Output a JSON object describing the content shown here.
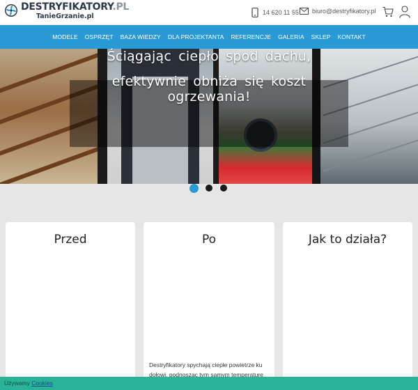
{
  "header": {
    "logo_main": "DESTRYFIKATORY",
    "logo_tld": ".PL",
    "logo_sub": "TanieGrzanie.pl",
    "phone": "14 620 11 55",
    "email": "biuro@destryfikatory.pl",
    "icons": [
      "fan-logo-icon",
      "phone-icon",
      "mail-icon",
      "cart-icon",
      "user-icon"
    ]
  },
  "nav": {
    "items": [
      "MODELE",
      "OSPRZĘT",
      "BAZA WIEDZY",
      "DLA PROJEKTANTA",
      "REFERENCJE",
      "GALERIA",
      "SKLEP",
      "KONTAKT"
    ]
  },
  "hero": {
    "line1": "Ściągając ciepło spod dachu,",
    "line2": "efektywnie obniża się koszt ogrzewania!",
    "slides": 3,
    "active_slide": 1
  },
  "cards": [
    {
      "title": "Przed",
      "text": ""
    },
    {
      "title": "Po",
      "text": "Destryfikatory spychają ciepłe powietrze ku dołowi, podnosząc tym samym temperature"
    },
    {
      "title": "Jak to działa?",
      "text": ""
    }
  ],
  "cookie": {
    "prefix": "Używamy",
    "link": "Cookies"
  },
  "colors": {
    "nav_bg": "#2a9ad6",
    "cookie_bg": "#2bb39a",
    "page_bg": "#e6e6e6"
  }
}
